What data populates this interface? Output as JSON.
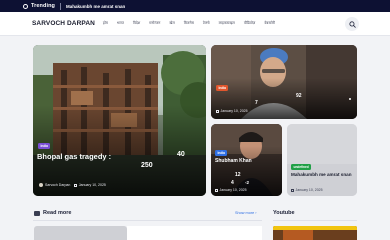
{
  "topbar": {
    "trending_label": "Trending",
    "headline": "Mahakumbh me amrat snan"
  },
  "header": {
    "logo": "SARVOCH DARPAN",
    "nav": [
      "होम",
      "भारत",
      "विदेश",
      "मनोरंजन",
      "खेल",
      "बिजनेस",
      "टेक्नो",
      "लाइफस्टाइल",
      "वीडियोज़",
      "वेबस्टोरी"
    ]
  },
  "cards": {
    "main": {
      "badge": "India",
      "title": "Bhopal gas tragedy :",
      "num_a": "40",
      "num_b": "250",
      "author": "Sarvoch Darpan",
      "date": "January 10, 2025"
    },
    "top_right": {
      "badge": "India",
      "num_a": "92",
      "num_b": "7",
      "date": "January 10, 2025"
    },
    "small_left": {
      "badge": "India",
      "title": "Shubham Khan",
      "num_a": "12",
      "num_b": "4",
      "num_c": "-2",
      "date": "January 10, 2025"
    },
    "small_right": {
      "badge": "undefined",
      "title": "Mahakumbh me amrat snan",
      "date": "January 10, 2025"
    }
  },
  "sections": {
    "read_more": "Read more",
    "show_more": "Show more",
    "youtube": "Youtube"
  },
  "colors": {
    "topbar": "#0d1133",
    "badge_india": "#7a4fd6",
    "badge_undefined": "#21a047",
    "accent_blue": "#2f6fe4"
  }
}
